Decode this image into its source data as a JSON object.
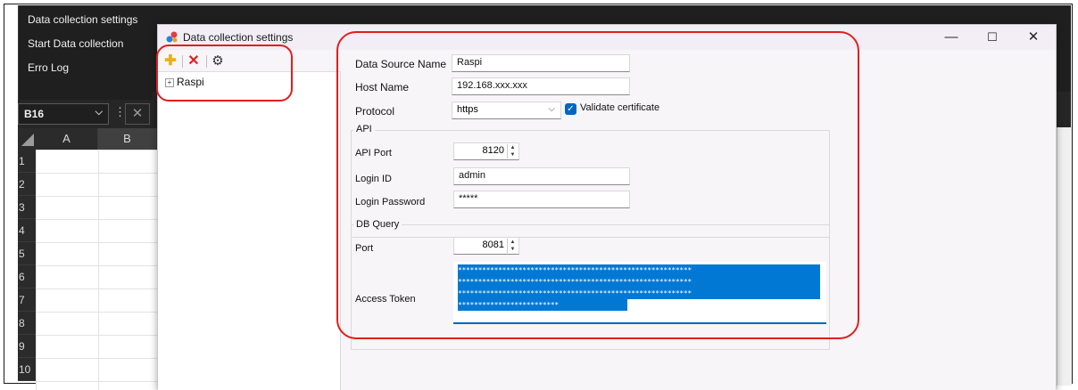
{
  "excel": {
    "menu_items": [
      "Data collection settings",
      "Start Data collection",
      "Erro Log"
    ],
    "name_box": "B16",
    "columns": [
      "A",
      "B"
    ],
    "rows": [
      "1",
      "2",
      "3",
      "4",
      "5",
      "6",
      "7",
      "8",
      "9",
      "10"
    ]
  },
  "dialog": {
    "title": "Data collection settings",
    "window_controls": {
      "minimize": "—",
      "maximize": "☐",
      "close": "✕"
    },
    "toolbar": {
      "add": "✚",
      "delete": "✕",
      "settings": "⚙"
    },
    "tree": [
      {
        "label": "Raspi",
        "expander": "+"
      }
    ]
  },
  "form": {
    "data_source_name": {
      "label": "Data Source Name",
      "value": "Raspi"
    },
    "host_name": {
      "label": "Host Name",
      "value": "192.168.xxx.xxx"
    },
    "protocol": {
      "label": "Protocol",
      "value": "https"
    },
    "validate_certificate": {
      "label": "Validate certificate",
      "checked": true
    },
    "api": {
      "title": "API",
      "port": {
        "label": "API Port",
        "value": "8120"
      },
      "login_id": {
        "label": "Login ID",
        "value": "admin"
      },
      "login_password": {
        "label": "Login Password",
        "value": "*****"
      }
    },
    "db_query": {
      "title": "DB Query",
      "port": {
        "label": "Port",
        "value": "8081"
      },
      "access_token": {
        "label": "Access Token",
        "lines": [
          "**********************************************************",
          "**********************************************************",
          "**********************************************************",
          "*************************"
        ]
      }
    }
  },
  "colors": {
    "accent": "#0067c0",
    "highlight_border": "#e01e1e",
    "excel_dark": "#1f1f1f"
  }
}
